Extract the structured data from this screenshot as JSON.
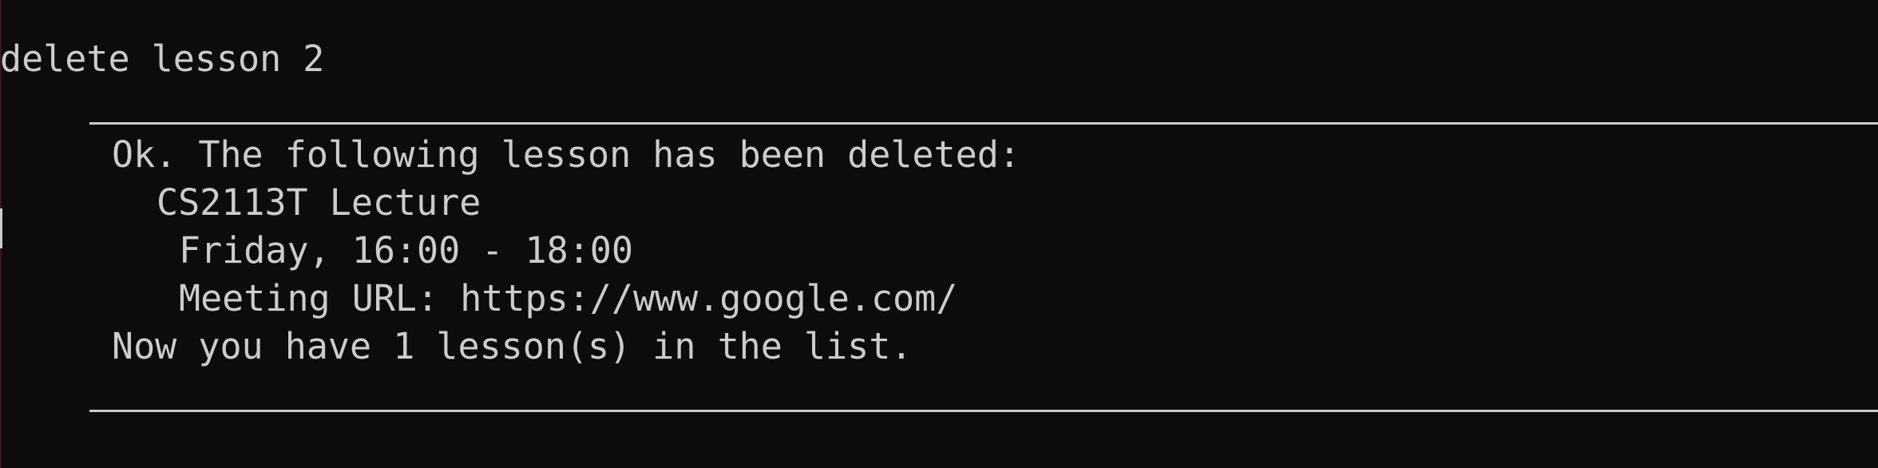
{
  "terminal": {
    "command": "delete lesson 2",
    "response": {
      "header": "Ok. The following lesson has been deleted:",
      "lesson_name": "CS2113T Lecture",
      "lesson_time": "Friday, 16:00 - 18:00",
      "lesson_url": "Meeting URL: https://www.google.com/",
      "summary": "Now you have 1 lesson(s) in the list."
    },
    "colors": {
      "background": "#0c0c0c",
      "foreground": "#cccccc"
    }
  }
}
